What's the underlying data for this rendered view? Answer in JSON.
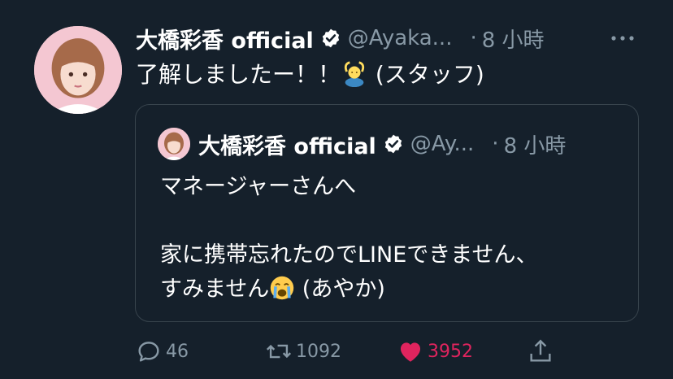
{
  "tweet": {
    "display_name": "大橋彩香 official",
    "handle": "@Ayaka...",
    "separator": "·",
    "time": "8 小時",
    "text_before_emoji": "了解しましたー！！",
    "emoji_name": "person-gesturing-ok-emoji",
    "text_after_emoji": " (スタッフ)"
  },
  "quoted": {
    "display_name": "大橋彩香 official",
    "handle": "@Ay...",
    "separator": "·",
    "time": "8 小時",
    "line1": "マネージャーさんへ",
    "line2": "",
    "line3": "家に携帯忘れたのでLINEできません、",
    "line4_before_emoji": "すみません",
    "emoji_name": "loudly-crying-face-emoji",
    "line4_after_emoji": " (あやか)"
  },
  "actions": {
    "reply_count": "46",
    "retweet_count": "1092",
    "like_count": "3952",
    "like_color": "#e0245e"
  },
  "colors": {
    "background": "#15202b",
    "secondary_text": "#8899a6",
    "border": "#38444d"
  },
  "icons": {
    "verified": "verified-badge-icon",
    "more": "more-dots-icon",
    "reply": "reply-icon",
    "retweet": "retweet-icon",
    "like": "heart-icon",
    "share": "share-icon"
  }
}
